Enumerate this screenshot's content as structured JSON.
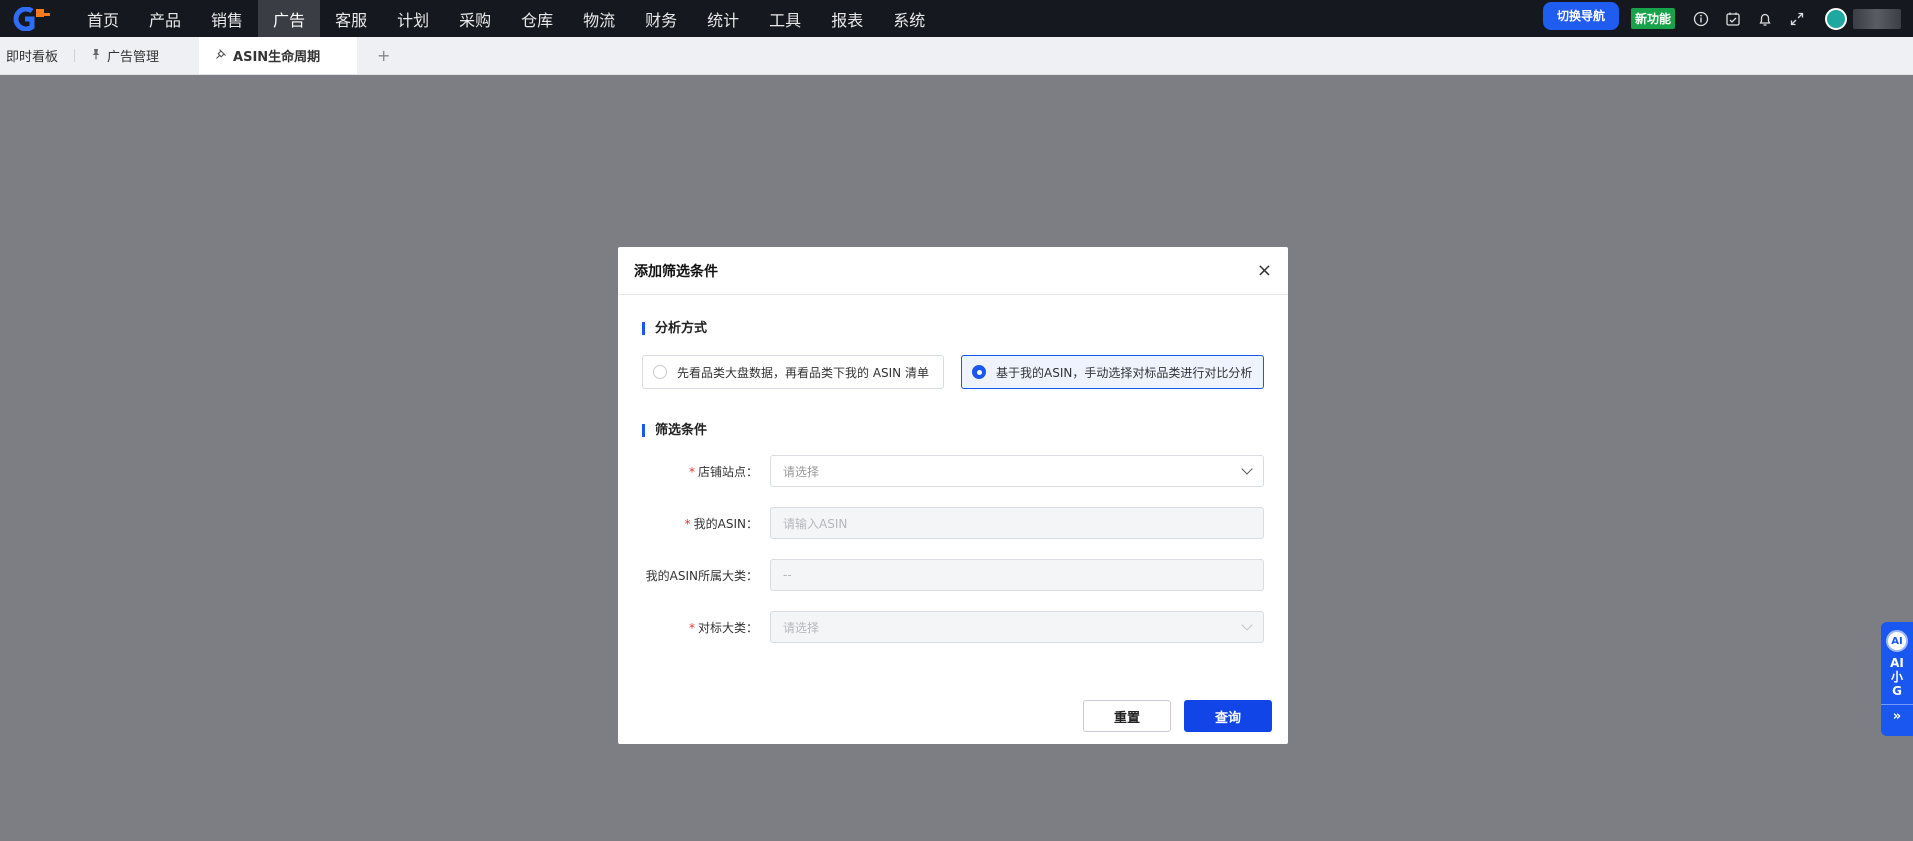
{
  "nav": {
    "items": [
      "首页",
      "产品",
      "销售",
      "广告",
      "客服",
      "计划",
      "采购",
      "仓库",
      "物流",
      "财务",
      "统计",
      "工具",
      "报表",
      "系统"
    ],
    "active": "广告",
    "switch_nav": "切换导航",
    "new_feature": "新功能"
  },
  "tabs": {
    "dashboard": "即时看板",
    "ad_manage": "广告管理",
    "asin_lifecycle": "ASIN生命周期",
    "add": "+"
  },
  "modal": {
    "title": "添加筛选条件",
    "close": "×",
    "analysis_title": "分析方式",
    "option1": "先看品类大盘数据，再看品类下我的 ASIN 清单",
    "option2": "基于我的ASIN，手动选择对标品类进行对比分析",
    "selected_option": 2,
    "filter_title": "筛选条件",
    "fields": {
      "store_label": "店铺站点：",
      "store_placeholder": "请选择",
      "asin_label": "我的ASIN：",
      "asin_placeholder": "请输入ASIN",
      "category_label": "我的ASIN所属大类：",
      "category_value": "--",
      "benchmark_label": "对标大类：",
      "benchmark_placeholder": "请选择"
    },
    "required_mark": "*",
    "reset": "重置",
    "query": "查询"
  },
  "ai": {
    "badge": "AI",
    "text": "AI小G",
    "expand": "»"
  },
  "colors": {
    "primary": "#1a56f0",
    "topbar": "#15181e",
    "new_badge": "#18a34a",
    "required": "#e53935"
  }
}
